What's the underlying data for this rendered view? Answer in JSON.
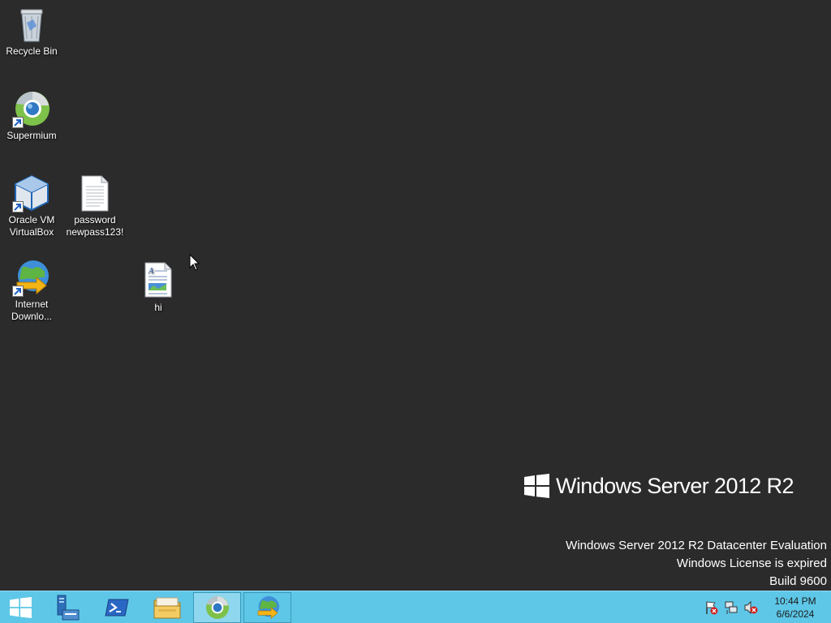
{
  "desktop": {
    "icons": [
      {
        "label": "Recycle Bin",
        "icon": "recycle-bin-icon"
      },
      {
        "label": "Supermium",
        "icon": "supermium-icon"
      },
      {
        "label": "Oracle VM\nVirtualBox",
        "icon": "virtualbox-icon"
      },
      {
        "label": "password\nnewpass123!",
        "icon": "text-document-icon"
      },
      {
        "label": "Internet\nDownlo...",
        "icon": "internet-download-manager-icon"
      },
      {
        "label": "hi",
        "icon": "wordpad-document-icon"
      }
    ]
  },
  "branding": {
    "text": "Windows Server 2012 R2"
  },
  "watermark": {
    "line1": "Windows Server 2012 R2 Datacenter Evaluation",
    "line2": "Windows License is expired",
    "line3": "Build 9600"
  },
  "taskbar": {
    "buttons": [
      {
        "name": "start-button",
        "icon": "windows-logo-icon"
      },
      {
        "name": "server-manager",
        "icon": "server-manager-icon"
      },
      {
        "name": "powershell",
        "icon": "powershell-icon"
      },
      {
        "name": "file-explorer",
        "icon": "folder-icon"
      },
      {
        "name": "supermium",
        "icon": "supermium-icon",
        "active": true
      },
      {
        "name": "internet-download-manager",
        "icon": "internet-download-manager-icon"
      }
    ],
    "tray": {
      "icons": [
        "action-center-flag-icon",
        "network-icon",
        "volume-muted-icon"
      ],
      "time": "10:44 PM",
      "date": "6/6/2024"
    }
  },
  "colors": {
    "desktop_bg": "#2b2b2b",
    "taskbar_bg": "#5ec7e8"
  }
}
